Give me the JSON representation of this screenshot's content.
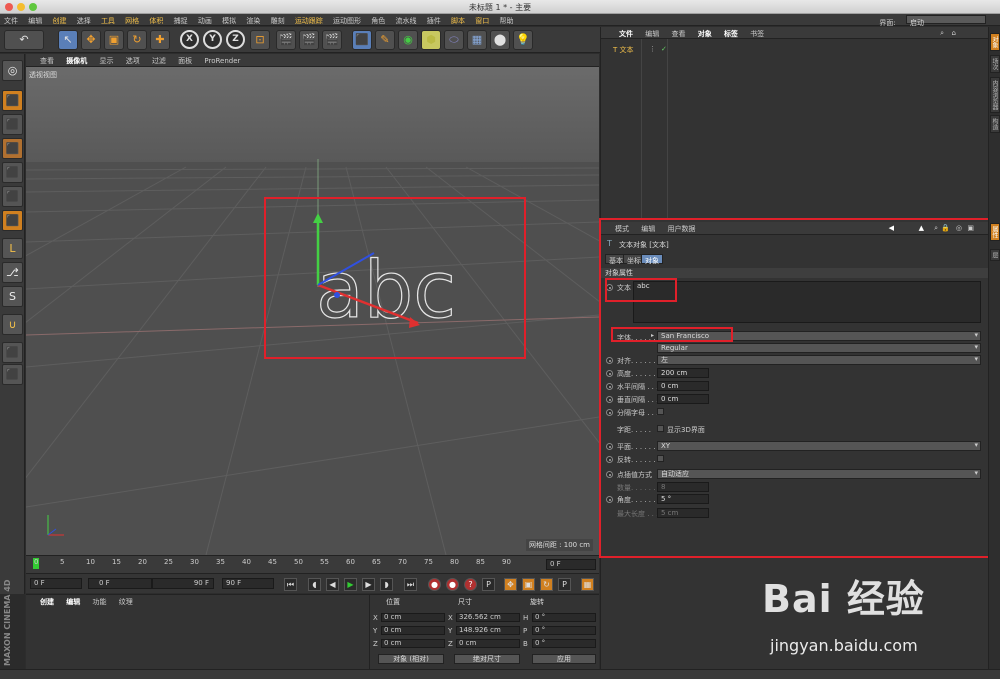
{
  "window": {
    "title": "未标题 1 * - 主要"
  },
  "menubar": {
    "items": [
      "文件",
      "编辑",
      "创建",
      "选择",
      "工具",
      "网格",
      "体积",
      "捕捉",
      "动画",
      "模拟",
      "渲染",
      "雕刻",
      "运动跟踪",
      "运动图形",
      "角色",
      "流水线",
      "插件",
      "脚本",
      "窗口",
      "帮助"
    ],
    "layout_label": "界面:",
    "layout_value": "启动"
  },
  "toolbar": {
    "undo": "↶",
    "tools": [
      "↖",
      "✥",
      "▣",
      "↻",
      "✚"
    ],
    "axes": [
      "X",
      "Y",
      "Z"
    ],
    "more": [
      "🎬",
      "🎬",
      "🎬",
      "⬛",
      "✎",
      "◉",
      "⬢",
      "⬭",
      "▦",
      "⬤",
      "💡"
    ]
  },
  "leftbar": {
    "icons": [
      "◎",
      "⬛",
      "⬛",
      "⬛",
      "⬛",
      "⬛",
      "⬛",
      "L",
      "⎇",
      "S",
      "∪",
      "⬛",
      "⬛"
    ]
  },
  "viewport": {
    "menu": [
      "查看",
      "摄像机",
      "显示",
      "选项",
      "过滤",
      "面板",
      "ProRender"
    ],
    "label": "透视视图",
    "grid_spacing": "网格间距 : 100 cm",
    "text_object": "abc"
  },
  "timeline": {
    "ticks": [
      "0",
      "5",
      "10",
      "15",
      "20",
      "25",
      "30",
      "35",
      "40",
      "45",
      "50",
      "55",
      "60",
      "65",
      "70",
      "75",
      "80",
      "85",
      "90"
    ],
    "end_field": "0 F",
    "start": "0 F",
    "range_start": "0 F",
    "range_end": "90 F",
    "end": "90 F"
  },
  "material": {
    "menu": [
      "创建",
      "编辑",
      "功能",
      "纹理"
    ],
    "brand": "MAXON CINEMA 4D"
  },
  "coords": {
    "headers": [
      "位置",
      "尺寸",
      "旋转"
    ],
    "rows": [
      {
        "pl": "X",
        "pv": "0 cm",
        "sl": "X",
        "sv": "326.562 cm",
        "rl": "H",
        "rv": "0 °"
      },
      {
        "pl": "Y",
        "pv": "0 cm",
        "sl": "Y",
        "sv": "148.926 cm",
        "rl": "P",
        "rv": "0 °"
      },
      {
        "pl": "Z",
        "pv": "0 cm",
        "sl": "Z",
        "sv": "0 cm",
        "rl": "B",
        "rv": "0 °"
      }
    ],
    "mode": "对象 (相对)",
    "size_mode": "绝对尺寸",
    "apply": "应用"
  },
  "objmgr": {
    "menu": [
      "文件",
      "编辑",
      "查看",
      "对象",
      "标签",
      "书签"
    ],
    "object": "文本"
  },
  "attrmgr": {
    "menu": [
      "模式",
      "编辑",
      "用户数据"
    ],
    "title": "文本对象 [文本]",
    "tabs": [
      "基本",
      "坐标",
      "对象"
    ],
    "section": "对象属性",
    "text_label": "文本",
    "text_value": "abc",
    "font_label": "字体. . . . . .",
    "font_value": "San Francisco",
    "style_value": "Regular",
    "align_label": "对齐. . . . . . .",
    "align_value": "左",
    "height_label": "高度. . . . . . .",
    "height_value": "200 cm",
    "hspace_label": "水平间隔 . . .",
    "hspace_value": "0 cm",
    "vspace_label": "垂直间隔 . . .",
    "vspace_value": "0 cm",
    "sep_label": "分隔字母 . . .",
    "kerning_label": "字距. . . . .",
    "show3d": "显示3D界面",
    "plane_label": "平面. . . . . . .",
    "plane_value": "XY",
    "reverse_label": "反转. . . . . . .",
    "interp_label": "点插值方式",
    "interp_value": "自动适应",
    "count_label": "数量. . . . . . .",
    "count_value": "8",
    "angle_label": "角度. . . . . . .",
    "angle_value": "5 °",
    "maxlen_label": "最大长度 . . .",
    "maxlen_value": "5 cm"
  },
  "rightstrip": {
    "tabs": [
      "对象",
      "场次",
      "内容浏览器",
      "构造",
      "属性",
      "层"
    ]
  },
  "watermark": {
    "logo": "Bai 经验",
    "url": "jingyan.baidu.com"
  },
  "colors": {
    "accent": "#f3c04a",
    "highlight_red": "#e0202a",
    "active_tab": "#6a8cbb"
  }
}
